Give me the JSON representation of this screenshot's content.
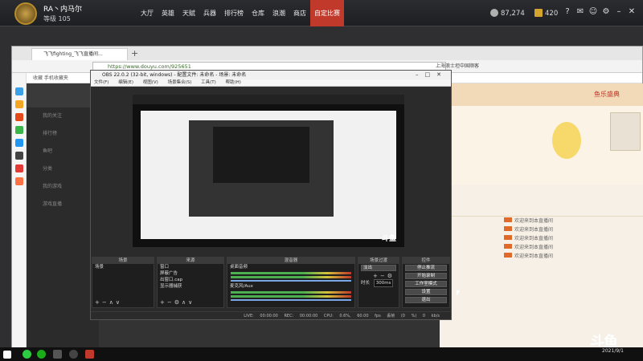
{
  "game_client": {
    "user_name": "RA丶内马尔",
    "level": "等级 105",
    "nav": [
      "大厅",
      "英雄",
      "天赋",
      "兵器",
      "排行榜",
      "仓库",
      "浪潮",
      "商店",
      "自定比赛"
    ],
    "active_nav": "自定比赛",
    "silver": "87,274",
    "gold": "420"
  },
  "browser": {
    "tab_title": "飞飞fighting_飞飞直播间...",
    "url": "https://www.douyu.com/925651",
    "search_text": "上海浪士坦中国顺客",
    "bookmarks": "收藏  手机收藏夹",
    "right_header": "鱼乐盛典"
  },
  "douyu_left": [
    "我的关注",
    "排行榜",
    "鱼吧",
    "分类",
    "我的游戏",
    "游戏直播"
  ],
  "chat": {
    "lines": [
      "欢迎来到本直播间",
      "欢迎来到本直播间",
      "欢迎来到本直播间",
      "欢迎来到本直播间",
      "欢迎来到本直播间"
    ]
  },
  "obs": {
    "title": "OBS 22.0.2 (32-bit, windows) - 配置文件: 未命名 - 场景: 未命名",
    "menu": [
      "文件(F)",
      "编辑(E)",
      "视图(V)",
      "场景集合(S)",
      "工具(T)",
      "帮助(H)"
    ],
    "docks": {
      "scenes_header": "场景",
      "scene_item": "场景",
      "sources_header": "来源",
      "sources": [
        "窗口",
        "屏蔽广告",
        "出窗口.cap",
        "显示器捕获"
      ],
      "mixer_header": "混音器",
      "mixer_tracks": [
        "桌面音频",
        "麦克风/Aux"
      ],
      "transitions_header": "场景过渡",
      "transition_value": "淡出",
      "duration_label": "时长",
      "duration_value": "300ms",
      "controls_header": "控件",
      "controls": [
        "停止推流",
        "开始录制",
        "工作室模式",
        "设置",
        "退出"
      ]
    },
    "status": {
      "live": "LIVE: 00:00:00",
      "rec": "REC: 00:00:00",
      "cpu": "CPU: 0.6%, 60.00 fps",
      "kbps": "丢帧 (0 %) 0 kb/s"
    }
  },
  "taskbar": {
    "time": "",
    "date": "2021/9/1"
  },
  "watermark": "斗鱼"
}
